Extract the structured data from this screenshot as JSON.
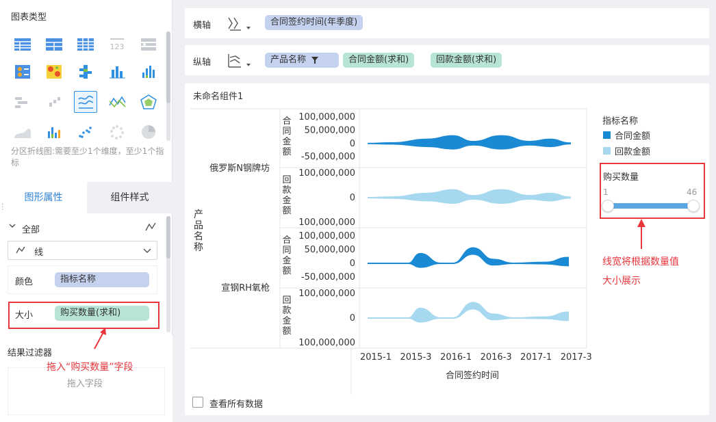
{
  "left_panel": {
    "chart_type_title": "图表类型",
    "hint": "分区折线图:需要至少1个维度，至少1个指标",
    "tabs": [
      "图形属性",
      "组件样式"
    ],
    "tree_all": "全部",
    "line_select": "线",
    "color_label": "颜色",
    "color_field": "指标名称",
    "size_label": "大小",
    "size_field": "购买数量(求和)",
    "filter_title": "结果过滤器",
    "filter_drop_hint": "拖入字段",
    "annotation_drag": "拖入“购买数量”字段"
  },
  "axes": {
    "x_label": "横轴",
    "x_field": "合同签约时间(年季度)",
    "y_label": "纵轴",
    "y_fields": [
      "产品名称",
      "合同金额(求和)",
      "回款金额(求和)"
    ]
  },
  "component": {
    "title": "未命名组件1",
    "view_all_label": "查看所有数据"
  },
  "legend": {
    "title": "指标名称",
    "items": [
      {
        "label": "合同金额",
        "color": "#1a8ad4"
      },
      {
        "label": "回款金额",
        "color": "#a6d8f0"
      }
    ],
    "size_title": "购买数量",
    "size_min": "1",
    "size_max": "46",
    "annotation": "线宽将根据数量值大小展示",
    "annotation_line1": "线宽将根据数量值",
    "annotation_line2": "大小展示"
  },
  "chart_data": {
    "type": "area",
    "x_title": "合同签约时间",
    "y_dim_title": "产品名称",
    "x_ticks": [
      "2015-1",
      "2015-3",
      "2016-1",
      "2016-3",
      "2017-1",
      "2017-3"
    ],
    "facets": [
      {
        "product": "俄罗斯N钢牌坊",
        "rows": [
          {
            "metric": "合同金额",
            "color": "#1a8ad4",
            "ticks": [
              "100,000,000",
              "50,000,000",
              "0",
              "-50,000,000"
            ],
            "ylim": [
              -70000000,
              110000000
            ],
            "y_tick_values": [
              100000000,
              50000000,
              0,
              -50000000
            ]
          },
          {
            "metric": "回款金额",
            "color": "#a6d8f0",
            "ticks": [
              "100,000,000",
              "0",
              "100,000,000"
            ],
            "ylim": [
              -100000000,
              100000000
            ],
            "y_tick_values": [
              100000000,
              0,
              -100000000
            ]
          }
        ]
      },
      {
        "product": "宣钢RH氧枪",
        "rows": [
          {
            "metric": "合同金额",
            "color": "#1a8ad4",
            "ticks": [
              "100,000,000",
              "50,000,000",
              "0",
              "-50,000,000"
            ],
            "ylim": [
              -70000000,
              110000000
            ],
            "y_tick_values": [
              100000000,
              50000000,
              0,
              -50000000
            ]
          },
          {
            "metric": "回款金额",
            "color": "#a6d8f0",
            "ticks": [
              "100,000,000",
              "0",
              "100,000,000"
            ],
            "ylim": [
              -100000000,
              100000000
            ],
            "y_tick_values": [
              100000000,
              0,
              -100000000
            ]
          }
        ]
      }
    ]
  }
}
